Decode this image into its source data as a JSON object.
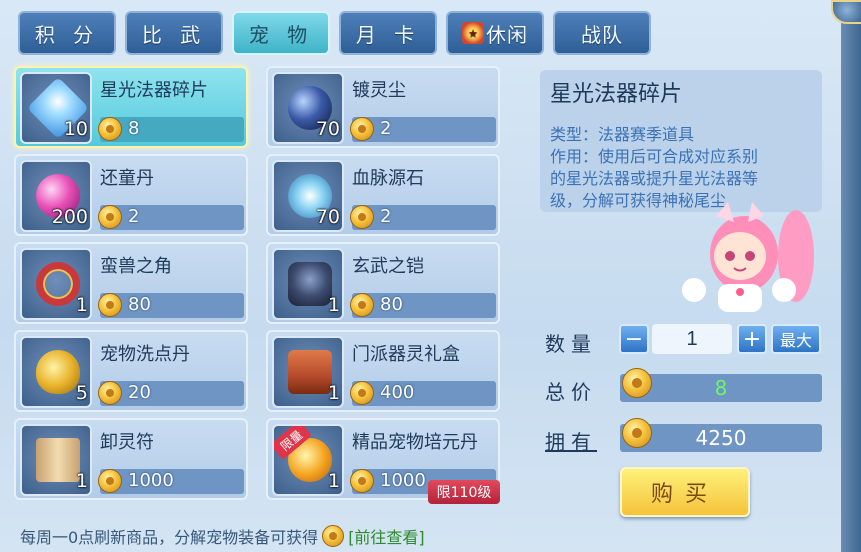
{
  "tabs": [
    {
      "label": "积 分"
    },
    {
      "label": "比 武"
    },
    {
      "label": "宠 物"
    },
    {
      "label": "月 卡"
    },
    {
      "label": "休闲",
      "icon": "badge-icon"
    },
    {
      "label": "战队"
    }
  ],
  "items": [
    {
      "name": "星光法器碎片",
      "qty": "10",
      "price": "8",
      "icon": "star-crystal-icon",
      "color": "#7fc6ff"
    },
    {
      "name": "镀灵尘",
      "qty": "70",
      "price": "2",
      "icon": "dark-orb-icon",
      "color": "#3a5aa8"
    },
    {
      "name": "还童丹",
      "qty": "200",
      "price": "2",
      "icon": "pink-pill-icon",
      "color": "#e84fb6"
    },
    {
      "name": "血脉源石",
      "qty": "70",
      "price": "2",
      "icon": "swirl-orb-icon",
      "color": "#8fd6f3"
    },
    {
      "name": "蛮兽之角",
      "qty": "1",
      "price": "80",
      "icon": "red-collar-icon",
      "color": "#c9383a"
    },
    {
      "name": "玄武之铠",
      "qty": "1",
      "price": "80",
      "icon": "armor-icon",
      "color": "#3c4a6e"
    },
    {
      "name": "宠物洗点丹",
      "qty": "5",
      "price": "20",
      "icon": "gourd-icon",
      "color": "#e8b22a"
    },
    {
      "name": "门派器灵礼盒",
      "qty": "1",
      "price": "400",
      "icon": "chest-icon",
      "color": "#b54a2a"
    },
    {
      "name": "卸灵符",
      "qty": "1",
      "price": "1000",
      "icon": "scroll-icon",
      "color": "#e6c89a"
    },
    {
      "name": "精品宠物培元丹",
      "qty": "1",
      "price": "1000",
      "icon": "golden-orb-icon",
      "color": "#f5a623",
      "ribbon": "限量",
      "limit": "限110级"
    }
  ],
  "detail": {
    "title": "星光法器碎片",
    "lines": [
      "类型：法器赛季道具",
      "作用：使用后可合成对应系别",
      "的星光法器或提升星光法器等",
      "级，分解可获得神秘尾尘"
    ]
  },
  "purchase": {
    "qty_label": "数量",
    "qty_value": "1",
    "minus": "−",
    "plus": "+",
    "max_label": "最大",
    "total_label": "总价",
    "total_value": "8",
    "own_label": "拥有",
    "own_value": "4250",
    "buy_label": "购买"
  },
  "footer": {
    "text": "每周一0点刷新商品，分解宠物装备可获得",
    "link": "[前往查看]"
  }
}
